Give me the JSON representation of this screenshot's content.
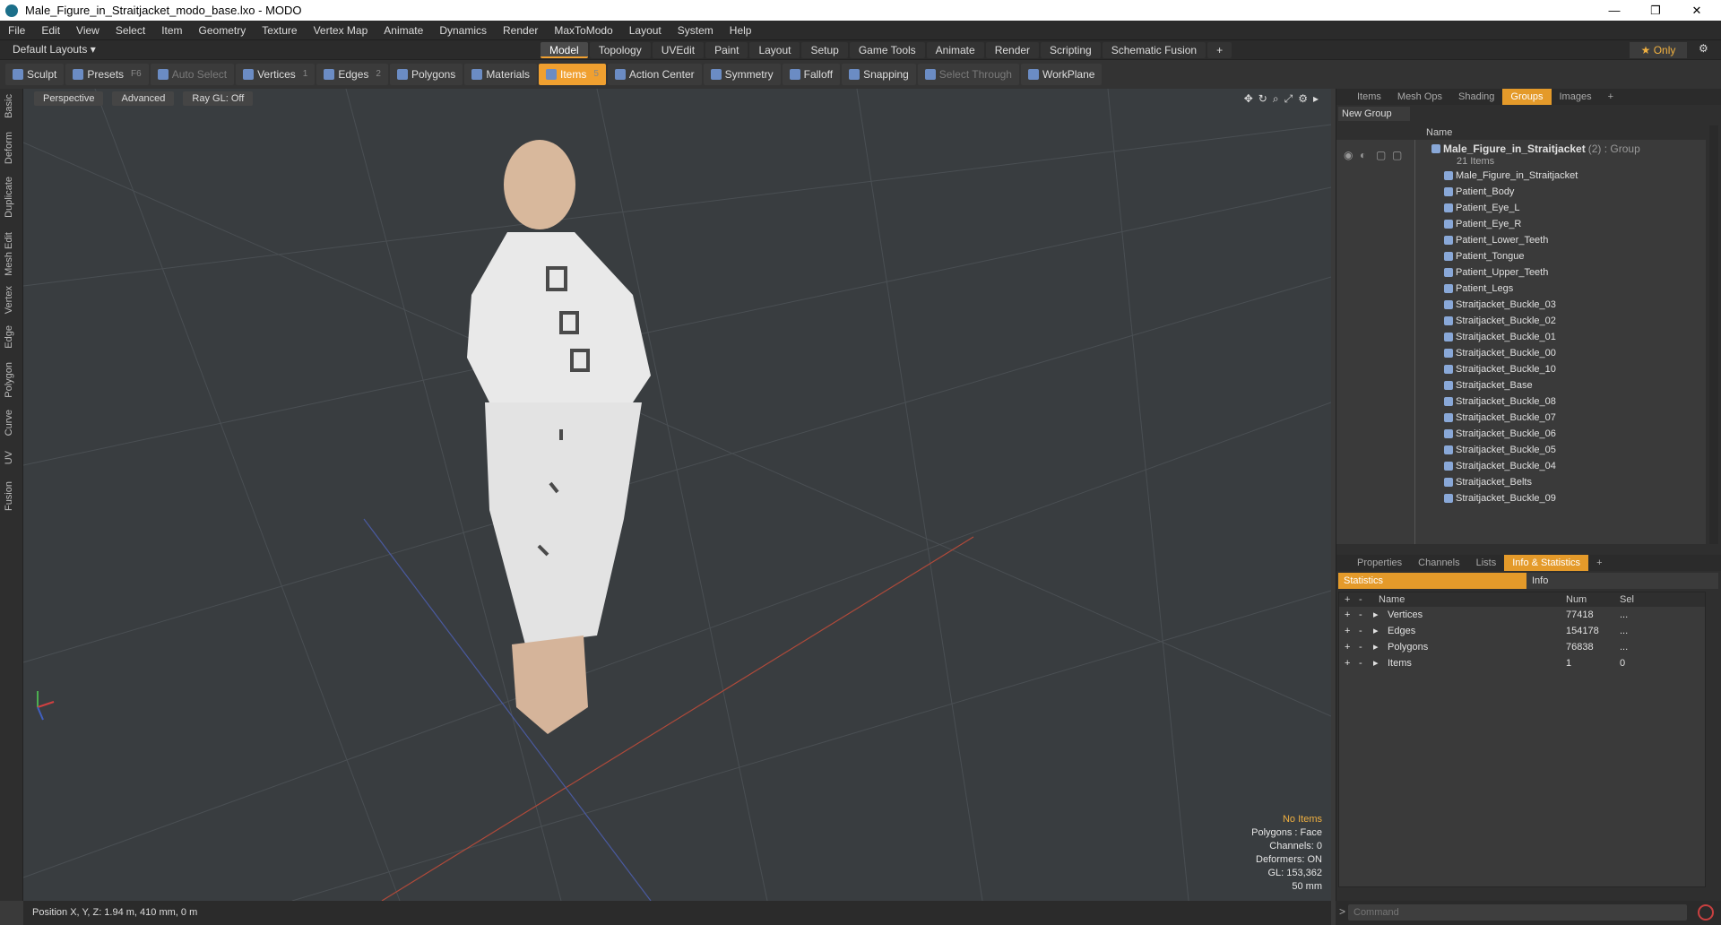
{
  "window": {
    "title": "Male_Figure_in_Straitjacket_modo_base.lxo - MODO",
    "minimize": "—",
    "maximize": "❐",
    "close": "✕"
  },
  "menu": [
    "File",
    "Edit",
    "View",
    "Select",
    "Item",
    "Geometry",
    "Texture",
    "Vertex Map",
    "Animate",
    "Dynamics",
    "Render",
    "MaxToModo",
    "Layout",
    "System",
    "Help"
  ],
  "layout": {
    "current": "Default Layouts ▾",
    "tabs": [
      "Model",
      "Topology",
      "UVEdit",
      "Paint",
      "Layout",
      "Setup",
      "Game Tools",
      "Animate",
      "Render",
      "Scripting",
      "Schematic Fusion"
    ],
    "active_tab": "Model",
    "add": "+",
    "only": "★ Only",
    "gear": "⚙"
  },
  "toolbar": {
    "sculpt": "Sculpt",
    "presets": "Presets",
    "presets_key": "F6",
    "auto_select": "Auto Select",
    "vertices": "Vertices",
    "vertices_key": "1",
    "edges": "Edges",
    "edges_key": "2",
    "polygons": "Polygons",
    "materials": "Materials",
    "items": "Items",
    "items_key": "5",
    "action_center": "Action Center",
    "symmetry": "Symmetry",
    "falloff": "Falloff",
    "snapping": "Snapping",
    "select_through": "Select Through",
    "workplane": "WorkPlane"
  },
  "left_tabs": [
    "Basic",
    "Deform",
    "Duplicate",
    "Mesh Edit",
    "Vertex",
    "Edge",
    "Polygon",
    "Curve",
    "UV",
    "Fusion"
  ],
  "viewport": {
    "perspective": "Perspective",
    "advanced": "Advanced",
    "raygl": "Ray GL: Off",
    "hud": {
      "no_items": "No Items",
      "polygons": "Polygons : Face",
      "channels": "Channels: 0",
      "deformers": "Deformers: ON",
      "gl": "GL: 153,362",
      "size": "50 mm"
    }
  },
  "status": {
    "position": "Position X, Y, Z:  1.94 m, 410 mm, 0 m"
  },
  "groups_panel": {
    "tabs": [
      "Items",
      "Mesh Ops",
      "Shading",
      "Groups",
      "Images",
      "+"
    ],
    "active": "Groups",
    "new_group": "New Group",
    "col_name": "Name",
    "group_name": "Male_Figure_in_Straitjacket",
    "group_suffix": "(2) : Group",
    "group_count": "21 Items",
    "items": [
      "Male_Figure_in_Straitjacket",
      "Patient_Body",
      "Patient_Eye_L",
      "Patient_Eye_R",
      "Patient_Lower_Teeth",
      "Patient_Tongue",
      "Patient_Upper_Teeth",
      "Patient_Legs",
      "Straitjacket_Buckle_03",
      "Straitjacket_Buckle_02",
      "Straitjacket_Buckle_01",
      "Straitjacket_Buckle_00",
      "Straitjacket_Buckle_10",
      "Straitjacket_Base",
      "Straitjacket_Buckle_08",
      "Straitjacket_Buckle_07",
      "Straitjacket_Buckle_06",
      "Straitjacket_Buckle_05",
      "Straitjacket_Buckle_04",
      "Straitjacket_Belts",
      "Straitjacket_Buckle_09"
    ]
  },
  "stats_panel": {
    "tabs": [
      "Properties",
      "Channels",
      "Lists",
      "Info & Statistics",
      "+"
    ],
    "active": "Info & Statistics",
    "sub_statistics": "Statistics",
    "sub_info": "Info",
    "headers": {
      "name": "Name",
      "num": "Num",
      "sel": "Sel",
      "plus": "+",
      "minus": "-"
    },
    "rows": [
      {
        "name": "Vertices",
        "num": "77418",
        "sel": "..."
      },
      {
        "name": "Edges",
        "num": "154178",
        "sel": "..."
      },
      {
        "name": "Polygons",
        "num": "76838",
        "sel": "..."
      },
      {
        "name": "Items",
        "num": "1",
        "sel": "0"
      }
    ]
  },
  "command": {
    "prompt": ">",
    "placeholder": "Command"
  },
  "colors": {
    "accent": "#f0a030",
    "viewport_bg": "#393d40"
  }
}
